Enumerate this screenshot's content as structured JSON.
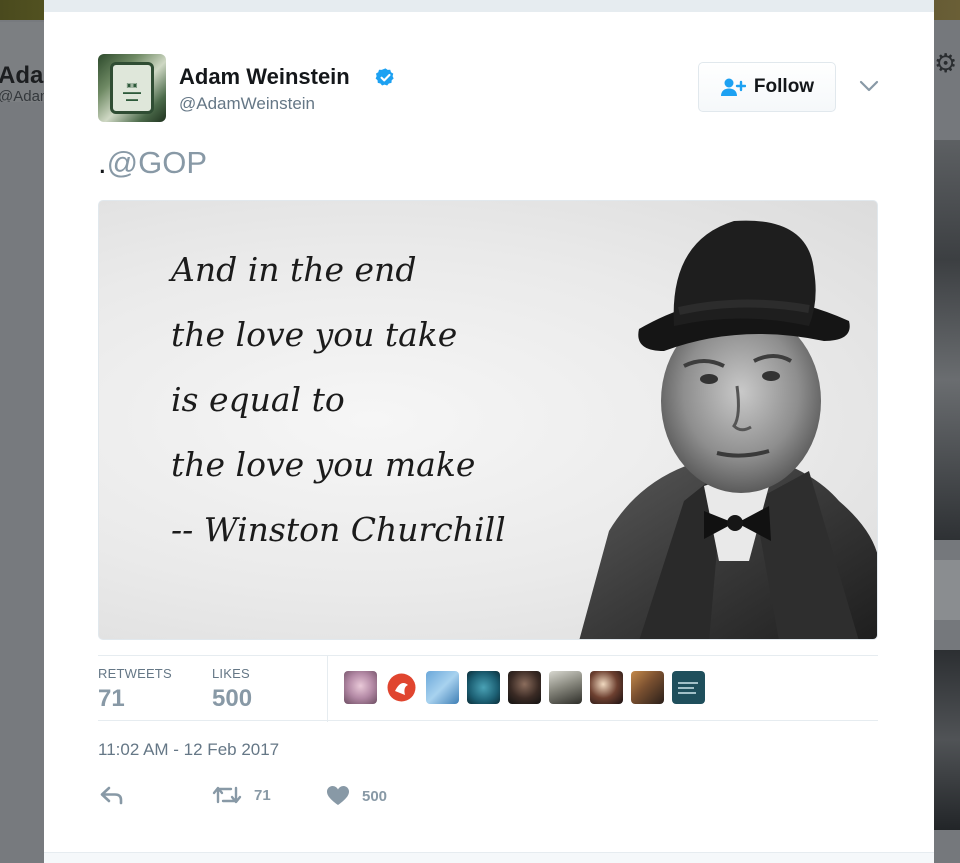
{
  "background": {
    "left_name": "Adam W",
    "left_handle": "@AdamWe",
    "right_icon": "gear-icon"
  },
  "tweet": {
    "display_name": "Adam Weinstein",
    "handle": "@AdamWeinstein",
    "verified": true,
    "follow_label": "Follow",
    "text_prefix": ".",
    "text_mention": "@GOP",
    "image_quote": [
      "And in the end",
      "the love you take",
      "is equal to",
      "the love you make",
      "-- Winston Churchill"
    ],
    "stats": {
      "retweets_label": "RETWEETS",
      "retweets_value": "71",
      "likes_label": "LIKES",
      "likes_value": "500"
    },
    "timestamp": "11:02 AM - 12 Feb 2017",
    "actions": {
      "reply_icon": "reply-icon",
      "retweet_count": "71",
      "like_count": "500"
    }
  },
  "colors": {
    "accent": "#1da1f2",
    "follow_icon": "#1da1f2",
    "muted_text": "#657786",
    "light_text": "#8899a6"
  }
}
